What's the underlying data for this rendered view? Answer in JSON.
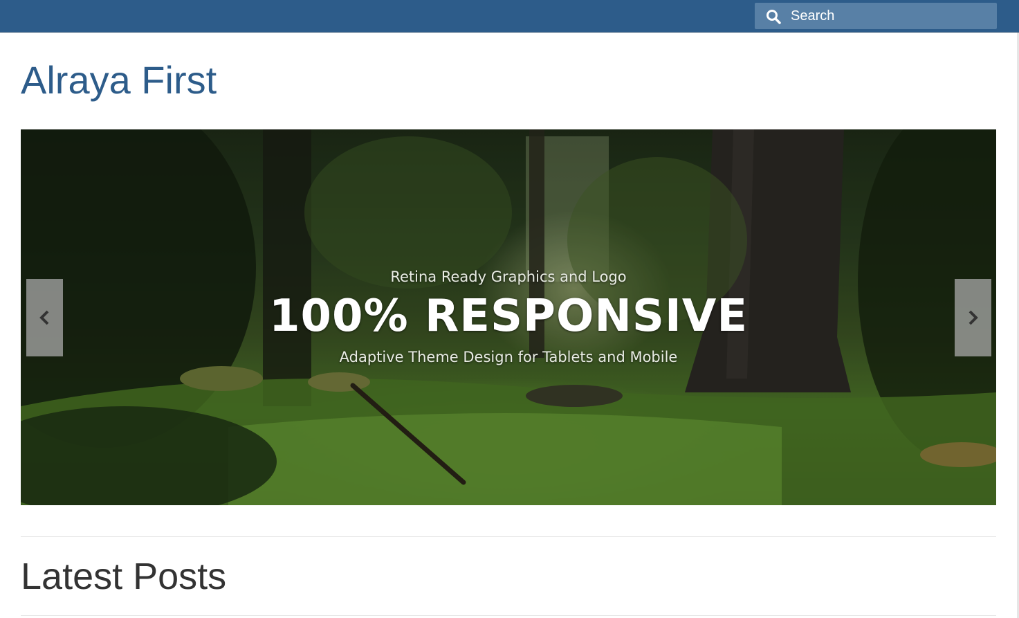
{
  "header": {
    "search": {
      "placeholder": "Search",
      "icon": "search-icon"
    },
    "bar_color": "#2d5c8a"
  },
  "site": {
    "title": "Alraya First",
    "title_color": "#2d5c8a"
  },
  "slider": {
    "caption_top": "Retina Ready Graphics and Logo",
    "caption_main": "100% RESPONSIVE",
    "caption_bottom": "Adaptive Theme Design for Tablets and Mobile",
    "prev_icon": "chevron-left-icon",
    "next_icon": "chevron-right-icon"
  },
  "main": {
    "section_title": "Latest Posts"
  }
}
